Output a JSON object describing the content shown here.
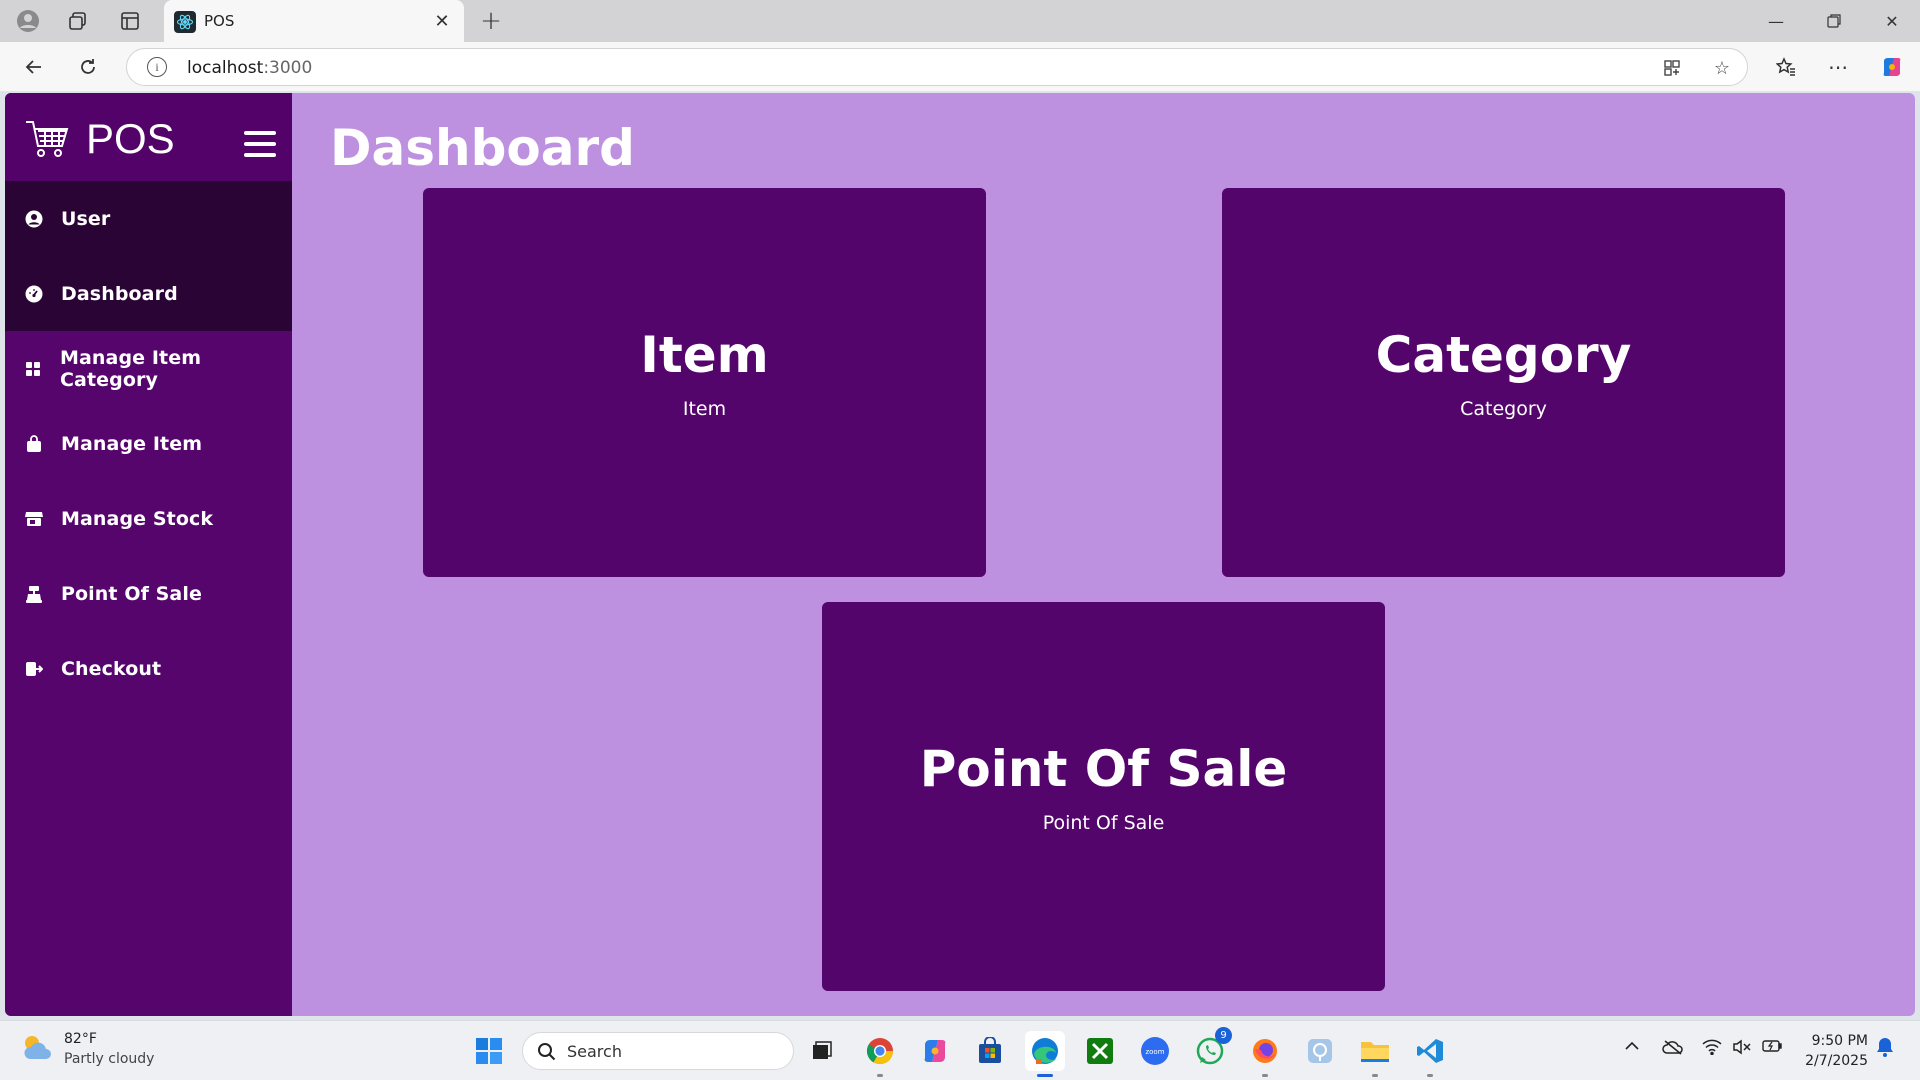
{
  "browser": {
    "tab_title": "POS",
    "url_host": "localhost",
    "url_port": ":3000"
  },
  "app": {
    "brand": "POS",
    "page_title": "Dashboard",
    "nav": [
      {
        "label": "User",
        "icon": "user-circle-icon",
        "active": true
      },
      {
        "label": "Dashboard",
        "icon": "gauge-icon",
        "active": true
      },
      {
        "label": "Manage Item Category",
        "icon": "grid-icon",
        "active": false
      },
      {
        "label": "Manage Item",
        "icon": "shopping-bag-icon",
        "active": false
      },
      {
        "label": "Manage Stock",
        "icon": "store-icon",
        "active": false
      },
      {
        "label": "Point Of Sale",
        "icon": "cash-register-icon",
        "active": false
      },
      {
        "label": "Checkout",
        "icon": "checkout-icon",
        "active": false
      }
    ],
    "cards": [
      {
        "title": "Item",
        "subtitle": "Item"
      },
      {
        "title": "Category",
        "subtitle": "Category"
      },
      {
        "title": "Point Of Sale",
        "subtitle": "Point Of Sale"
      }
    ],
    "colors": {
      "content_bg": "#be91e0",
      "sidebar_bg": "#55056b",
      "active_nav_bg": "#2b0436",
      "card_bg": "#54056b"
    }
  },
  "taskbar": {
    "weather_temp": "82°F",
    "weather_desc": "Partly cloudy",
    "search_label": "Search",
    "whatsapp_badge": "9",
    "time": "9:50 PM",
    "date": "2/7/2025"
  }
}
